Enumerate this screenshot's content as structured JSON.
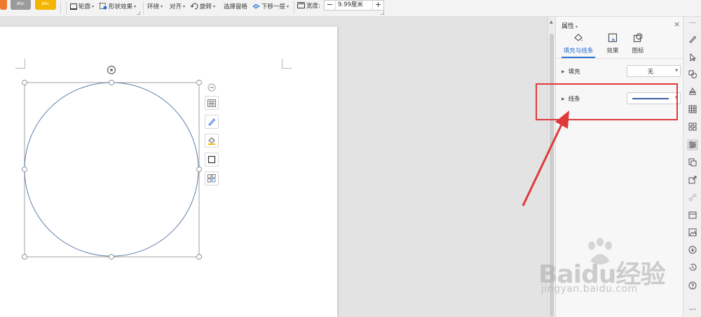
{
  "toolbar": {
    "style_swatch_label": "Abc",
    "outline_label": "轮廓",
    "shape_effect_label": "形状效果",
    "wrap_label": "环绕",
    "align_label": "对齐",
    "rotate_label": "旋转",
    "selection_pane_label": "选择窗格",
    "send_backward_label": "下移一层",
    "width_label": "宽度:",
    "width_value": "9.99厘米",
    "minus": "−",
    "plus": "+"
  },
  "panel": {
    "title": "属性",
    "close": "×",
    "tabs": [
      {
        "label": "填充与线条",
        "active": true
      },
      {
        "label": "效果",
        "active": false
      },
      {
        "label": "图标",
        "active": false
      }
    ],
    "fill": {
      "label": "填充",
      "value": "无"
    },
    "line": {
      "label": "线条"
    }
  },
  "colors": {
    "accent": "#2b6fd6",
    "annotation_red": "#e0393a",
    "line_color": "#3a5fa0",
    "swatch_orange": "#f07a2c",
    "swatch_gray": "#9b9b9b",
    "swatch_yellow": "#f5b400"
  },
  "watermark": {
    "logo": "Baidu经验",
    "url": "jingyan.baidu.com"
  }
}
